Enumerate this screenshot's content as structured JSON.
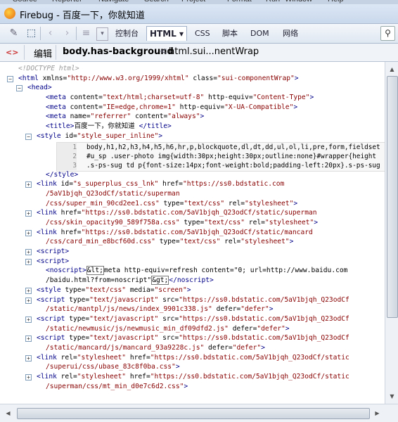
{
  "menu": [
    "Source",
    "Reporter",
    "Navigate",
    "Search",
    "Project",
    "Format",
    "Run",
    "Window",
    "Help"
  ],
  "window": {
    "title": "Firebug - 百度一下，你就知道"
  },
  "toolbar": {
    "tabs": [
      "控制台",
      "HTML",
      "CSS",
      "脚本",
      "DOM",
      "网络"
    ],
    "html_tab": "HTML ▾"
  },
  "breadcrumb": {
    "edit_label": "编辑",
    "selected": "body.has-background",
    "separator": "<",
    "parent": "html.sui...nentWrap"
  },
  "html_lines": [
    {
      "indent": 0,
      "toggle": "",
      "segs": [
        [
          "doctype",
          "<!DOCTYPE html>"
        ]
      ]
    },
    {
      "indent": 0,
      "toggle": "−",
      "segs": [
        [
          "tag",
          "<html "
        ],
        [
          "attr",
          "xmlns="
        ],
        [
          "val",
          "\"http://www.w3.org/1999/xhtml\""
        ],
        [
          "attr",
          " class="
        ],
        [
          "val",
          "\"sui-componentWrap\""
        ],
        [
          "tag",
          ">"
        ]
      ]
    },
    {
      "indent": 1,
      "toggle": "−",
      "segs": [
        [
          "tag",
          "<head>"
        ]
      ]
    },
    {
      "indent": 3,
      "toggle": "",
      "segs": [
        [
          "tag",
          "<meta "
        ],
        [
          "attr",
          "content="
        ],
        [
          "val",
          "\"text/html;charset=utf-8\""
        ],
        [
          "attr",
          " http-equiv="
        ],
        [
          "val",
          "\"Content-Type\""
        ],
        [
          "tag",
          ">"
        ]
      ]
    },
    {
      "indent": 3,
      "toggle": "",
      "segs": [
        [
          "tag",
          "<meta "
        ],
        [
          "attr",
          "content="
        ],
        [
          "val",
          "\"IE=edge,chrome=1\""
        ],
        [
          "attr",
          " http-equiv="
        ],
        [
          "val",
          "\"X-UA-Compatible\""
        ],
        [
          "tag",
          ">"
        ]
      ]
    },
    {
      "indent": 3,
      "toggle": "",
      "segs": [
        [
          "tag",
          "<meta "
        ],
        [
          "attr",
          "name="
        ],
        [
          "val",
          "\"referrer\""
        ],
        [
          "attr",
          " content="
        ],
        [
          "val",
          "\"always\""
        ],
        [
          "tag",
          ">"
        ]
      ]
    },
    {
      "indent": 3,
      "toggle": "",
      "segs": [
        [
          "tag",
          "<title>"
        ],
        [
          "attr",
          "百度一下，你就知道 "
        ],
        [
          "tag",
          "</title>"
        ]
      ]
    },
    {
      "indent": 2,
      "toggle": "−",
      "segs": [
        [
          "tag",
          "<style "
        ],
        [
          "attr",
          "id="
        ],
        [
          "val",
          "\"style_super_inline\""
        ],
        [
          "tag",
          ">"
        ]
      ]
    },
    {
      "indent": 0,
      "toggle": "",
      "segs": [
        [
          "attr",
          ""
        ]
      ],
      "css": true
    },
    {
      "indent": 0,
      "toggle": "",
      "segs": [
        [
          "attr",
          ""
        ]
      ]
    },
    {
      "indent": 0,
      "toggle": "",
      "segs": [
        [
          "attr",
          ""
        ]
      ]
    },
    {
      "indent": 3,
      "toggle": "",
      "segs": [
        [
          "tag",
          "</style>"
        ]
      ]
    },
    {
      "indent": 2,
      "toggle": "+",
      "segs": [
        [
          "tag",
          "<link "
        ],
        [
          "attr",
          "id="
        ],
        [
          "val",
          "\"s_superplus_css_lnk\""
        ],
        [
          "attr",
          " href="
        ],
        [
          "val",
          "\"https://ss0.bdstatic.com"
        ]
      ]
    },
    {
      "indent": 3,
      "toggle": "",
      "segs": [
        [
          "val",
          "/5aV1bjqh_Q23odCf/static/superman"
        ]
      ]
    },
    {
      "indent": 3,
      "toggle": "",
      "segs": [
        [
          "val",
          "/css/super_min_90cd2ee1.css\""
        ],
        [
          "attr",
          " type="
        ],
        [
          "val",
          "\"text/css\""
        ],
        [
          "attr",
          " rel="
        ],
        [
          "val",
          "\"stylesheet\""
        ],
        [
          "tag",
          ">"
        ]
      ]
    },
    {
      "indent": 2,
      "toggle": "+",
      "segs": [
        [
          "tag",
          "<link "
        ],
        [
          "attr",
          "href="
        ],
        [
          "val",
          "\"https://ss0.bdstatic.com/5aV1bjqh_Q23odCf/static/superman"
        ]
      ]
    },
    {
      "indent": 3,
      "toggle": "",
      "segs": [
        [
          "val",
          "/css/skin_opacity90_589f758a.css\""
        ],
        [
          "attr",
          " type="
        ],
        [
          "val",
          "\"text/css\""
        ],
        [
          "attr",
          " rel="
        ],
        [
          "val",
          "\"stylesheet\""
        ],
        [
          "tag",
          ">"
        ]
      ]
    },
    {
      "indent": 2,
      "toggle": "+",
      "segs": [
        [
          "tag",
          "<link "
        ],
        [
          "attr",
          "href="
        ],
        [
          "val",
          "\"https://ss0.bdstatic.com/5aV1bjqh_Q23odCf/static/mancard"
        ]
      ]
    },
    {
      "indent": 3,
      "toggle": "",
      "segs": [
        [
          "val",
          "/css/card_min_e8bcf60d.css\""
        ],
        [
          "attr",
          " type="
        ],
        [
          "val",
          "\"text/css\""
        ],
        [
          "attr",
          " rel="
        ],
        [
          "val",
          "\"stylesheet\""
        ],
        [
          "tag",
          ">"
        ]
      ]
    },
    {
      "indent": 2,
      "toggle": "+",
      "segs": [
        [
          "tag",
          "<script>"
        ]
      ]
    },
    {
      "indent": 2,
      "toggle": "+",
      "segs": [
        [
          "tag",
          "<script>"
        ]
      ]
    },
    {
      "indent": 3,
      "toggle": "",
      "segs": [
        [
          "tag",
          "<noscript>"
        ],
        [
          "esc",
          "&lt;"
        ],
        [
          "attr",
          "meta http-equiv=refresh content=\"0; url=http://www.baidu.com"
        ]
      ]
    },
    {
      "indent": 3,
      "toggle": "",
      "segs": [
        [
          "attr",
          "/baidu.html?from=noscript\""
        ],
        [
          "esc",
          "&gt;"
        ],
        [
          "tag",
          "</noscript>"
        ]
      ]
    },
    {
      "indent": 2,
      "toggle": "+",
      "segs": [
        [
          "tag",
          "<style "
        ],
        [
          "attr",
          "type="
        ],
        [
          "val",
          "\"text/css\""
        ],
        [
          "attr",
          " media="
        ],
        [
          "val",
          "\"screen\""
        ],
        [
          "tag",
          ">"
        ]
      ]
    },
    {
      "indent": 2,
      "toggle": "+",
      "segs": [
        [
          "tag",
          "<script "
        ],
        [
          "attr",
          "type="
        ],
        [
          "val",
          "\"text/javascript\""
        ],
        [
          "attr",
          " src="
        ],
        [
          "val",
          "\"https://ss0.bdstatic.com/5aV1bjqh_Q23odCf"
        ]
      ]
    },
    {
      "indent": 3,
      "toggle": "",
      "segs": [
        [
          "val",
          "/static/mantpl/js/news/index_9901c338.js\""
        ],
        [
          "attr",
          " defer="
        ],
        [
          "val",
          "\"defer\""
        ],
        [
          "tag",
          ">"
        ]
      ]
    },
    {
      "indent": 2,
      "toggle": "+",
      "segs": [
        [
          "tag",
          "<script "
        ],
        [
          "attr",
          "type="
        ],
        [
          "val",
          "\"text/javascript\""
        ],
        [
          "attr",
          " src="
        ],
        [
          "val",
          "\"https://ss0.bdstatic.com/5aV1bjqh_Q23odCf"
        ]
      ]
    },
    {
      "indent": 3,
      "toggle": "",
      "segs": [
        [
          "val",
          "/static/newmusic/js/newmusic_min_df09dfd2.js\""
        ],
        [
          "attr",
          " defer="
        ],
        [
          "val",
          "\"defer\""
        ],
        [
          "tag",
          ">"
        ]
      ]
    },
    {
      "indent": 2,
      "toggle": "+",
      "segs": [
        [
          "tag",
          "<script "
        ],
        [
          "attr",
          "type="
        ],
        [
          "val",
          "\"text/javascript\""
        ],
        [
          "attr",
          " src="
        ],
        [
          "val",
          "\"https://ss0.bdstatic.com/5aV1bjqh_Q23odCf"
        ]
      ]
    },
    {
      "indent": 3,
      "toggle": "",
      "segs": [
        [
          "val",
          "/static/mancard/js/mancard_93a9228c.js\""
        ],
        [
          "attr",
          " defer="
        ],
        [
          "val",
          "\"defer\""
        ],
        [
          "tag",
          ">"
        ]
      ]
    },
    {
      "indent": 2,
      "toggle": "+",
      "segs": [
        [
          "tag",
          "<link "
        ],
        [
          "attr",
          "rel="
        ],
        [
          "val",
          "\"stylesheet\""
        ],
        [
          "attr",
          " href="
        ],
        [
          "val",
          "\"https://ss0.bdstatic.com/5aV1bjqh_Q23odCf/static"
        ]
      ]
    },
    {
      "indent": 3,
      "toggle": "",
      "segs": [
        [
          "val",
          "/superui/css/ubase_83c8f0ba.css\""
        ],
        [
          "tag",
          ">"
        ]
      ]
    },
    {
      "indent": 2,
      "toggle": "+",
      "segs": [
        [
          "tag",
          "<link "
        ],
        [
          "attr",
          "rel="
        ],
        [
          "val",
          "\"stylesheet\""
        ],
        [
          "attr",
          " href="
        ],
        [
          "val",
          "\"https://ss0.bdstatic.com/5aV1bjqh_Q23odCf/static"
        ]
      ]
    },
    {
      "indent": 3,
      "toggle": "",
      "segs": [
        [
          "val",
          "/superman/css/mt_min_d0e7c6d2.css\""
        ],
        [
          "tag",
          ">"
        ]
      ]
    }
  ],
  "css_rows": [
    {
      "num": "1",
      "text": "body,h1,h2,h3,h4,h5,h6,hr,p,blockquote,dl,dt,dd,ul,ol,li,pre,form,fieldset"
    },
    {
      "num": "2",
      "text": "#u_sp .user-photo img{width:30px;height:30px;outline:none}#wrapper{height"
    },
    {
      "num": "3",
      "text": ".s-ps-sug td p{font-size:14px;font-weight:bold;padding-left:20px}.s-ps-sug"
    }
  ],
  "colors": {
    "tag": "#000088",
    "value": "#880000",
    "panel_bg": "#ffffff",
    "chrome_bg": "#d9e3f0"
  }
}
